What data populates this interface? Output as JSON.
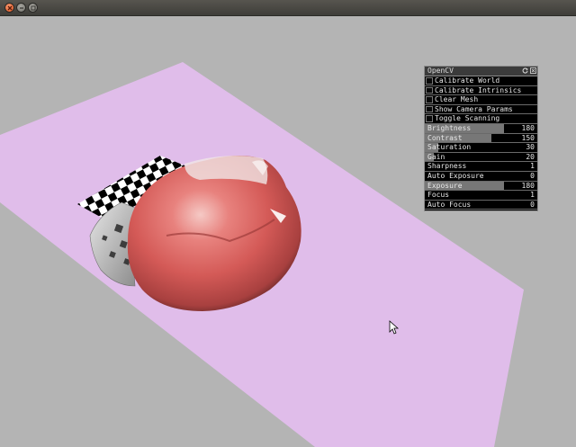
{
  "window": {
    "buttons": [
      "close",
      "minimize",
      "maximize"
    ]
  },
  "scene": {
    "background_color": "#b4b4b4",
    "ground_plane_color": "#e0bdea",
    "object_color": "#d9615f"
  },
  "panel": {
    "title": "OpenCV",
    "buttons": [
      {
        "label": "Calibrate World"
      },
      {
        "label": "Calibrate Intrinsics"
      },
      {
        "label": "Clear Mesh"
      },
      {
        "label": "Show Camera Params"
      },
      {
        "label": "Toggle Scanning"
      }
    ],
    "sliders": [
      {
        "label": "Brightness",
        "value": "180",
        "fill": 0.706
      },
      {
        "label": "Contrast",
        "value": "150",
        "fill": 0.588
      },
      {
        "label": "Saturation",
        "value": "30",
        "fill": 0.118
      },
      {
        "label": "Gain",
        "value": "20",
        "fill": 0.078
      },
      {
        "label": "Sharpness",
        "value": "1",
        "fill": 0.0
      },
      {
        "label": "Auto Exposure",
        "value": "0",
        "fill": 0.0
      },
      {
        "label": "Exposure",
        "value": "180",
        "fill": 0.706
      },
      {
        "label": "Focus",
        "value": "1",
        "fill": 0.0
      },
      {
        "label": "Auto Focus",
        "value": "0",
        "fill": 0.0
      }
    ]
  }
}
